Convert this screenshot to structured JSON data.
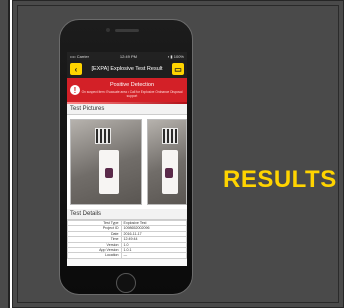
{
  "status_bar": {
    "carrier": "•••• Carrier",
    "time": "12:49 PM",
    "battery": "▪ ▮ 100%"
  },
  "app": {
    "title": "[EXPA] Explosive Test Result",
    "back_icon": "chevron-left-icon",
    "menu_icon": "document-icon",
    "accent": "#ffd400"
  },
  "alert": {
    "title": "Positive Detection",
    "subtitle": "On suspect item: Evacuate area • Call for Explosive Ordnance Disposal support",
    "color": "#d32027"
  },
  "test_pictures": {
    "heading": "Test Pictures"
  },
  "test_details": {
    "heading": "Test Details",
    "rows": [
      {
        "key": "Test Type",
        "value": "Explosive Test"
      },
      {
        "key": "Project ID",
        "value": "1098652002096"
      },
      {
        "key": "Date",
        "value": "2016-11-17"
      },
      {
        "key": "Time",
        "value": "12:49:44"
      },
      {
        "key": "Version",
        "value": "1.0"
      },
      {
        "key": "App Version",
        "value": "1.0.1"
      },
      {
        "key": "Location",
        "value": "—"
      }
    ]
  },
  "results_label": "RESULTS"
}
